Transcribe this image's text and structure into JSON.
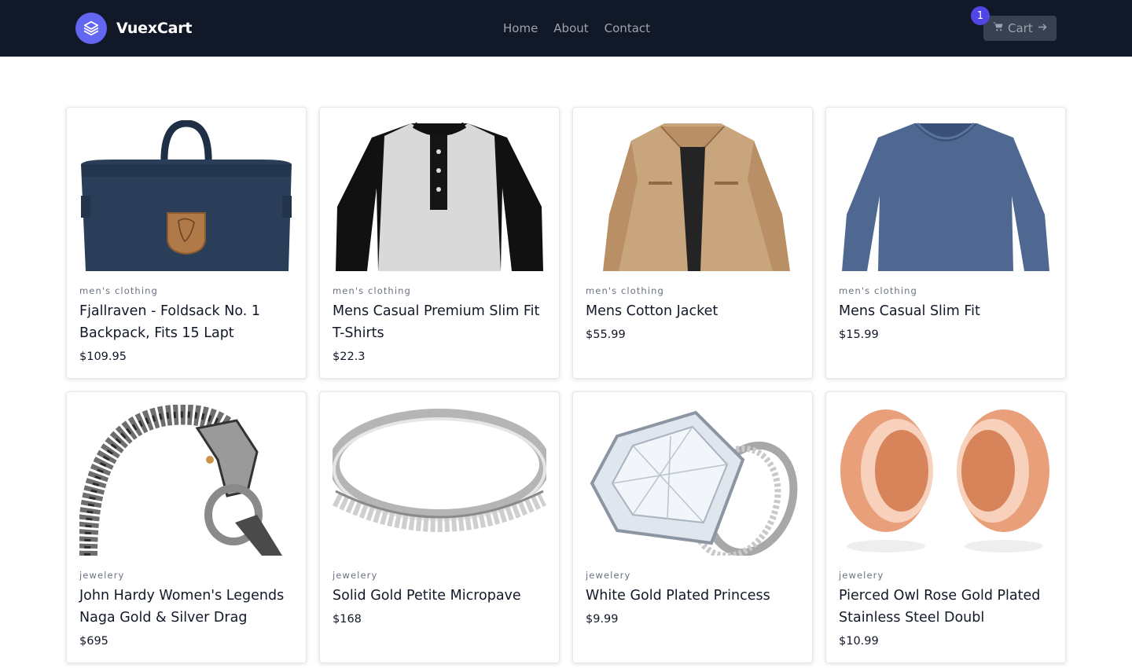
{
  "header": {
    "brand_name": "VuexCart",
    "nav": [
      "Home",
      "About",
      "Contact"
    ],
    "cart_label": "Cart",
    "cart_count": "1",
    "brand_color": "#6366f1",
    "badge_color": "#4f46e5",
    "bar_color": "#111827"
  },
  "products": [
    {
      "category": "men's clothing",
      "title": "Fjallraven - Foldsack No. 1 Backpack, Fits 15 Lapt",
      "price": "$109.95",
      "image": "backpack"
    },
    {
      "category": "men's clothing",
      "title": "Mens Casual Premium Slim Fit T-Shirts",
      "price": "$22.3",
      "image": "raglan-tshirt"
    },
    {
      "category": "men's clothing",
      "title": "Mens Cotton Jacket",
      "price": "$55.99",
      "image": "jacket"
    },
    {
      "category": "men's clothing",
      "title": "Mens Casual Slim Fit",
      "price": "$15.99",
      "image": "blue-longsleeve"
    },
    {
      "category": "jewelery",
      "title": "John Hardy Women's Legends Naga Gold & Silver Drag",
      "price": "$695",
      "image": "dragon-bracelet"
    },
    {
      "category": "jewelery",
      "title": "Solid Gold Petite Micropave",
      "price": "$168",
      "image": "silver-band"
    },
    {
      "category": "jewelery",
      "title": "White Gold Plated Princess",
      "price": "$9.99",
      "image": "diamond-ring"
    },
    {
      "category": "jewelery",
      "title": "Pierced Owl Rose Gold Plated Stainless Steel Doubl",
      "price": "$10.99",
      "image": "rose-gold-plugs"
    }
  ]
}
